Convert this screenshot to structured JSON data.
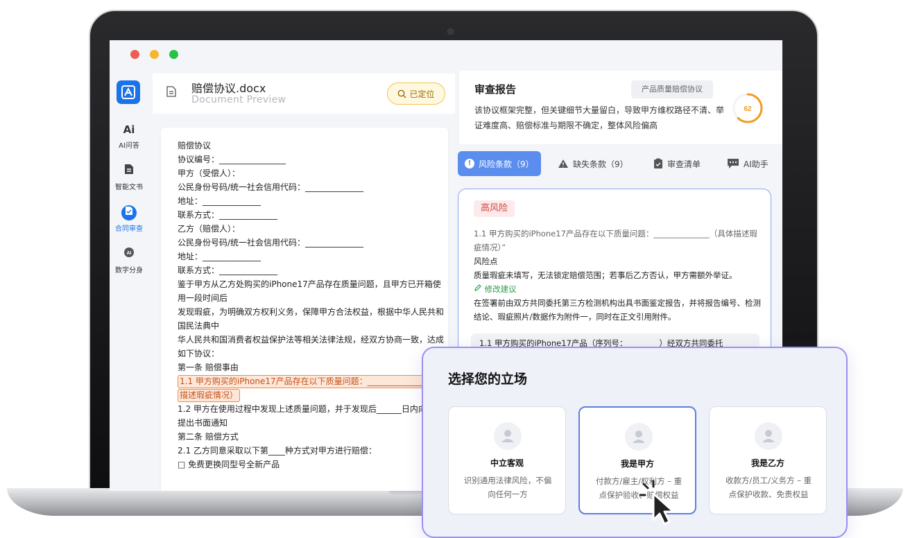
{
  "window": {
    "dots": [
      "#ee5d55",
      "#f5b52e",
      "#27c246"
    ]
  },
  "sidebar": {
    "items": [
      {
        "label": "AI问答",
        "icon": "ai-icon"
      },
      {
        "label": "智能文书",
        "icon": "document-icon"
      },
      {
        "label": "合同审查",
        "icon": "contract-review-icon",
        "active": true
      },
      {
        "label": "数字分身",
        "icon": "digital-avatar-icon"
      }
    ]
  },
  "document": {
    "file_name": "赔偿协议.docx",
    "subtitle": "Document Preview",
    "located_label": "已定位",
    "lines": [
      "赔偿协议",
      "协议编号：________________",
      "甲方（受偿人）：",
      "公民身份号码/统一社会信用代码：______________",
      "地址：______________",
      "联系方式：______________",
      "乙方（赔偿人）：",
      "公民身份号码/统一社会信用代码：______________",
      "地址：______________",
      "联系方式：______________",
      "鉴于甲方从乙方处购买的iPhone17产品存在质量问题，且甲方已开箱使",
      "用一段时间后",
      "发现瑕疵，为明确双方权利义务，保障甲方合法权益，根据中华人民共和",
      "国民法典中",
      "华人民共和国消费者权益保护法等相关法律法规，经双方协商一致，达成",
      "如下协议：",
      "第一条 赔偿事由"
    ],
    "highlight_line_1": "1.1 甲方购买的iPhone17产品存在以下质量问题：______________（具体",
    "highlight_line_2": "描述瑕疵情况）",
    "after_lines": [
      "1.2 甲方在使用过程中发现上述质量问题，并于发现后______日内向乙方",
      "提出书面通知",
      "第二条 赔偿方式",
      "2.1 乙方同意采取以下第____种方式对甲方进行赔偿：",
      "□ 免费更换同型号全新产品"
    ]
  },
  "report": {
    "title": "审查报告",
    "tag": "产品质量赔偿协议",
    "summary": "该协议框架完整，但关键细节大量留白，导致甲方维权路径不清、举证难度高、赔偿标准与期限不确定，整体风险偏高",
    "score": 62,
    "score_color": "#f29a1f"
  },
  "tabs": [
    {
      "label": "风险条款（9）",
      "icon": "exclamation-icon",
      "active": true
    },
    {
      "label": "缺失条款（9）",
      "icon": "warning-triangle-icon"
    },
    {
      "label": "审查清单",
      "icon": "checklist-icon"
    },
    {
      "label": "AI助手",
      "icon": "chat-icon"
    }
  ],
  "risk": {
    "level": "高风险",
    "clause": "1.1 甲方购买的iPhone17产品存在以下质量问题：______________（具体描述瑕疵情况）”",
    "point_label": "风险点",
    "point_text": "质量瑕疵未填写，无法锁定赔偿范围；若事后乙方否认，甲方需额外举证。",
    "suggest_label": "修改建议",
    "suggest_text": "在签署前由双方共同委托第三方检测机构出具书面鉴定报告，并将报告编号、检测结论、瑕疵照片/数据作为附件一，同时在正文引用附件。",
    "quote": "1.1 甲方购买的iPhone17产品（序列号：________）经双方共同委托"
  },
  "stance": {
    "title": "选择您的立场",
    "options": [
      {
        "title": "中立客观",
        "desc": "识别通用法律风险，不偏向任何一方"
      },
      {
        "title": "我是甲方",
        "desc": "付款方/雇主/权利方 – 重点保护验收、赔偿权益",
        "selected": true
      },
      {
        "title": "我是乙方",
        "desc": "收款方/员工/义务方 – 重点保护收款、免责权益"
      }
    ]
  }
}
